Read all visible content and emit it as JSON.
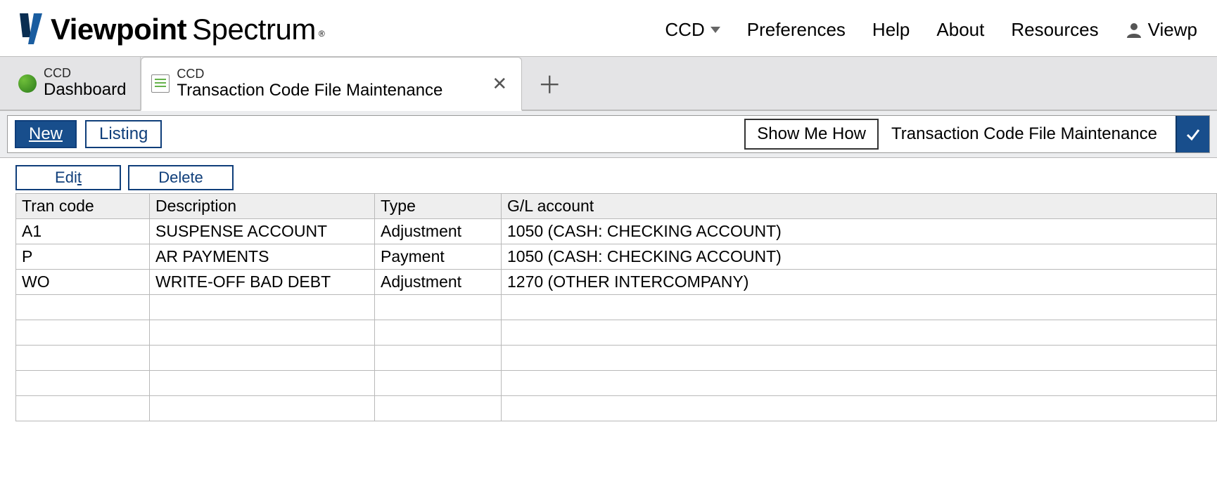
{
  "brand": {
    "name1": "Viewpoint",
    "name2": "Spectrum",
    "reg": "®"
  },
  "nav": {
    "company": "CCD",
    "preferences": "Preferences",
    "help": "Help",
    "about": "About",
    "resources": "Resources",
    "user": "Viewp"
  },
  "tabs": [
    {
      "small": "CCD",
      "big": "Dashboard"
    },
    {
      "small": "CCD",
      "big": "Transaction Code File Maintenance",
      "active": true
    }
  ],
  "toolbar": {
    "new_label": "New",
    "listing_label": "Listing",
    "show_me_how": "Show Me How",
    "page_title": "Transaction Code File Maintenance"
  },
  "grid_actions": {
    "edit_html": "Edi<span class='underline'>t</span>",
    "delete_label": "Delete"
  },
  "columns": {
    "tran_code": "Tran code",
    "description": "Description",
    "type": "Type",
    "gl_account": "G/L account"
  },
  "rows": [
    {
      "code": "A1",
      "desc": "SUSPENSE ACCOUNT",
      "type": "Adjustment",
      "gl": "1050 (CASH: CHECKING ACCOUNT)"
    },
    {
      "code": "P",
      "desc": "AR PAYMENTS",
      "type": "Payment",
      "gl": "1050 (CASH: CHECKING ACCOUNT)"
    },
    {
      "code": "WO",
      "desc": "WRITE-OFF BAD DEBT",
      "type": "Adjustment",
      "gl": "1270 (OTHER INTERCOMPANY)"
    }
  ],
  "empty_rows": 5
}
